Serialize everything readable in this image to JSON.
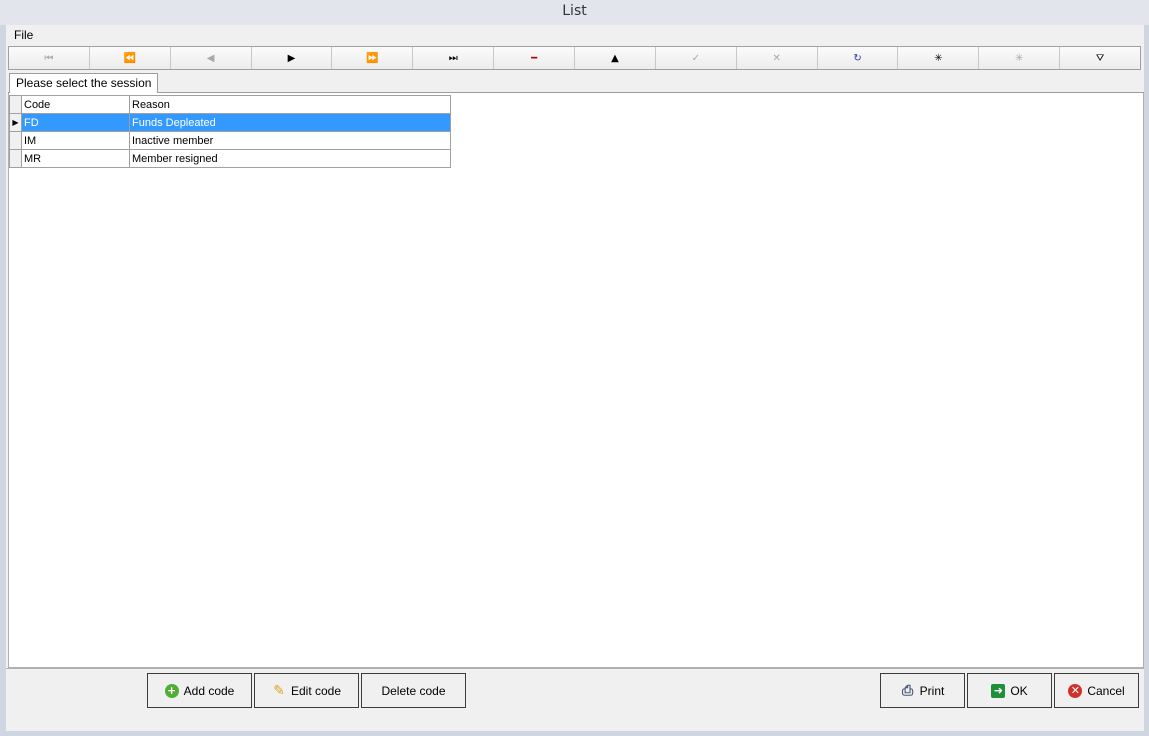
{
  "window": {
    "title": "List"
  },
  "menu": {
    "file": "File"
  },
  "navigator": {
    "buttons": [
      {
        "icon": "first-record-icon",
        "glyph": "⏮",
        "enabled": false
      },
      {
        "icon": "prior-page-icon",
        "glyph": "⏪",
        "enabled": false
      },
      {
        "icon": "prior-record-icon",
        "glyph": "◀",
        "enabled": false
      },
      {
        "icon": "next-record-icon",
        "glyph": "▶",
        "enabled": true
      },
      {
        "icon": "next-page-icon",
        "glyph": "⏩",
        "enabled": true
      },
      {
        "icon": "last-record-icon",
        "glyph": "⏭",
        "enabled": true
      },
      {
        "icon": "delete-record-icon",
        "glyph": "━",
        "enabled": true
      },
      {
        "icon": "edit-record-icon",
        "glyph": "▲",
        "enabled": true
      },
      {
        "icon": "post-edit-icon",
        "glyph": "✓",
        "enabled": false
      },
      {
        "icon": "cancel-edit-icon",
        "glyph": "✕",
        "enabled": false
      },
      {
        "icon": "refresh-icon",
        "glyph": "↻",
        "enabled": true
      },
      {
        "icon": "insert-record-icon",
        "glyph": "✳",
        "enabled": true
      },
      {
        "icon": "append-record-icon",
        "glyph": "✳",
        "enabled": false
      },
      {
        "icon": "filter-icon",
        "glyph": "⛛",
        "enabled": true
      }
    ]
  },
  "tab": {
    "label": "Please select the session"
  },
  "grid": {
    "columns": [
      "Code",
      "Reason"
    ],
    "rows": [
      {
        "code": "FD",
        "reason": "Funds Depleated",
        "selected": true
      },
      {
        "code": "IM",
        "reason": "Inactive member",
        "selected": false
      },
      {
        "code": "MR",
        "reason": "Member resigned",
        "selected": false
      }
    ],
    "current_row_indicator": "▶"
  },
  "buttons": {
    "add_code": "Add code",
    "edit_code": "Edit code",
    "delete_code": "Delete code",
    "print": "Print",
    "ok": "OK",
    "cancel": "Cancel"
  },
  "colors": {
    "selection": "#3399ff",
    "window_bg": "#f0f0f0"
  }
}
